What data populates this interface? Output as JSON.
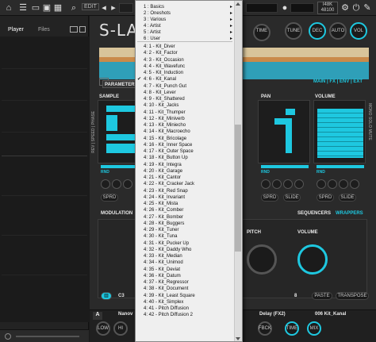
{
  "topbar": {
    "edit_label": "EDIT",
    "cpu_lines": [
      "I48K",
      "256",
      "48100"
    ]
  },
  "browser": {
    "tab_player": "Player",
    "tab_files": "Files"
  },
  "plugin": {
    "logo": "S-LAY",
    "knobs": [
      "TIME",
      "TUNE",
      "DEC",
      "AUTO",
      "VOL"
    ],
    "parameter_label": "PARAMETER",
    "view_tabs": "MAIN | FX | ENV | EXT",
    "sample_label": "SAMPLE",
    "pan_label": "PAN",
    "volume_label": "VOLUME",
    "speed_label": "REV | SPEED | PHASE",
    "mono_label": "MONO SOLO MUTE",
    "rnd_label": "RND",
    "sprd_label": "SPRD",
    "slide_label": "SLIDE",
    "modulation_label": "MODULATION",
    "sequencers_label": "SEQUENCERS",
    "wrappers_label": "WRAPPERS",
    "pitch_label": "PITCH",
    "volume_knob_label": "VOLUME",
    "paste_label": "PASTE",
    "transpose_label": "TRANSPOSE",
    "c3_label": "C3",
    "step_label": "8"
  },
  "bottombar": {
    "nano_label": "Nanov",
    "delay_label": "Delay (FX2)",
    "kit_label": "006 Kit_Kanal",
    "knobs": [
      "LOW",
      "HI",
      "TIME",
      "MIX",
      "FBCK"
    ],
    "a_label": "A"
  },
  "menu": {
    "categories": [
      "1 : Basics",
      "2 : Oneshots",
      "3 : Various",
      "4 : Artist",
      "5 : Artist",
      "6 : User"
    ],
    "items": [
      "4: 1 - Kit_Diver",
      "4: 2 - Kit_Factor",
      "4: 3 - Kit_Occasion",
      "4: 4 - Kit_Wavefunc",
      "4: 5 - Kit_Induction",
      "4: 6 - Kit_Kanal",
      "4: 7 - Kit_Punch Gut",
      "4: 8 - Kit_Lever",
      "4: 9 - Kit_Shattered",
      "4: 10 - Kit_Jacks",
      "4: 11 - Kit_Thumper",
      "4: 12 - Kit_Miniverb",
      "4: 13 - Kit_Miniecho",
      "4: 14 - Kit_Macroecho",
      "4: 15 - Kit_Bricolage",
      "4: 16 - Kit_Inner Space",
      "4: 17 - Kit_Outer Space",
      "4: 18 - Kit_Button Up",
      "4: 19 - Kit_Integra",
      "4: 20 - Kit_Garage",
      "4: 21 - Kit_Cantor",
      "4: 22 - Kit_Cracker Jack",
      "4: 23 - Kit_Red Snap",
      "4: 24 - Kit_Invariant",
      "4: 25 - Kit_Mista",
      "4: 26 - Kit_Comber",
      "4: 27 - Kit_Bomber",
      "4: 28 - Kit_Buggers",
      "4: 29 - Kit_Tuner",
      "4: 30 - Kit_Tuna",
      "4: 31 - Kit_Pucker Up",
      "4: 32 - Kit_Daddy Who",
      "4: 33 - Kit_Median",
      "4: 34 - Kit_Unimod",
      "4: 35 - Kit_Deviat",
      "4: 36 - Kit_Datum",
      "4: 37 - Kit_Regressor",
      "4: 38 - Kit_Document",
      "4: 39 - Kit_Least Square",
      "4: 40 - Kit_Simplex",
      "4: 41 - Pitch Diffusion",
      "4: 42 - Pitch Diffusion 2"
    ],
    "checked_index": 5,
    "check_glyph": "✔"
  },
  "colors": {
    "accent": "#1ec8e0",
    "menu_bg": "#efefef",
    "panel_bg": "#2a2a2a"
  }
}
